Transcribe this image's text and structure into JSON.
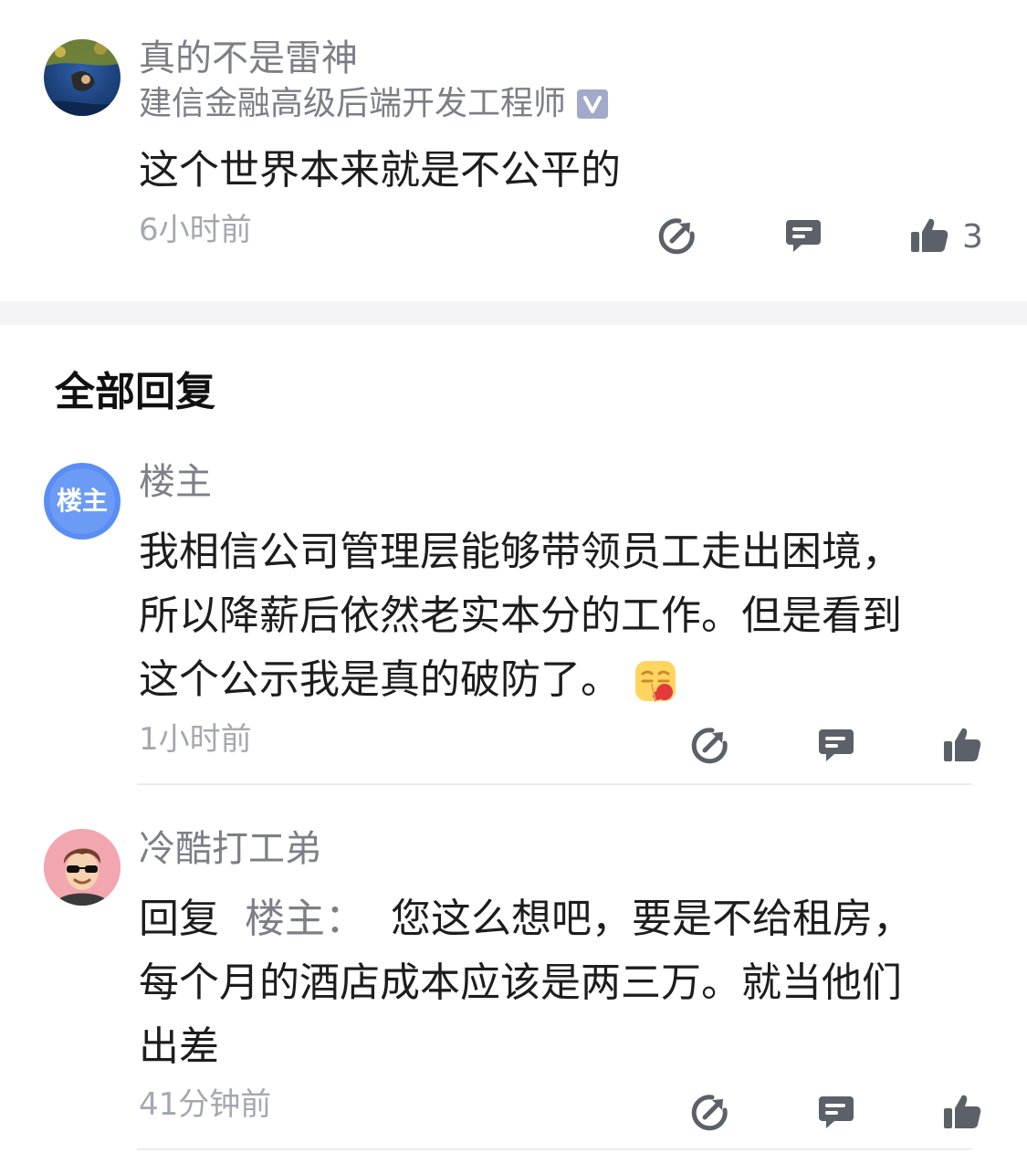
{
  "main_comment": {
    "author": "真的不是雷神",
    "job": "建信金融高级后端开发工程师",
    "verified_badge": "V",
    "text": "这个世界本来就是不公平的",
    "time": "6小时前",
    "like_count": "3",
    "icons": [
      "share-icon",
      "comment-icon",
      "thumbs-up-icon"
    ]
  },
  "replies_header": "全部回复",
  "replies": [
    {
      "author": "楼主",
      "avatar_text": "楼主",
      "lines": [
        "我相信公司管理层能够带领员工走出困境，",
        "所以降薪后依然老实本分的工作。但是看到",
        "这个公示我是真的破防了。"
      ],
      "emoji": "😷",
      "time": "1小时前"
    },
    {
      "author": "冷酷打工弟",
      "reply_prefix": "回复",
      "reply_target": "楼主：",
      "lines": [
        "您这么想吧，要是不给租房，",
        "每个月的酒店成本应该是两三万。就当他们",
        "出差"
      ],
      "time": "41分钟前"
    }
  ],
  "colors": {
    "accent_blue": "#5b8ef4",
    "icon_gray": "#5c6068",
    "divider": "#f4f4f6"
  }
}
